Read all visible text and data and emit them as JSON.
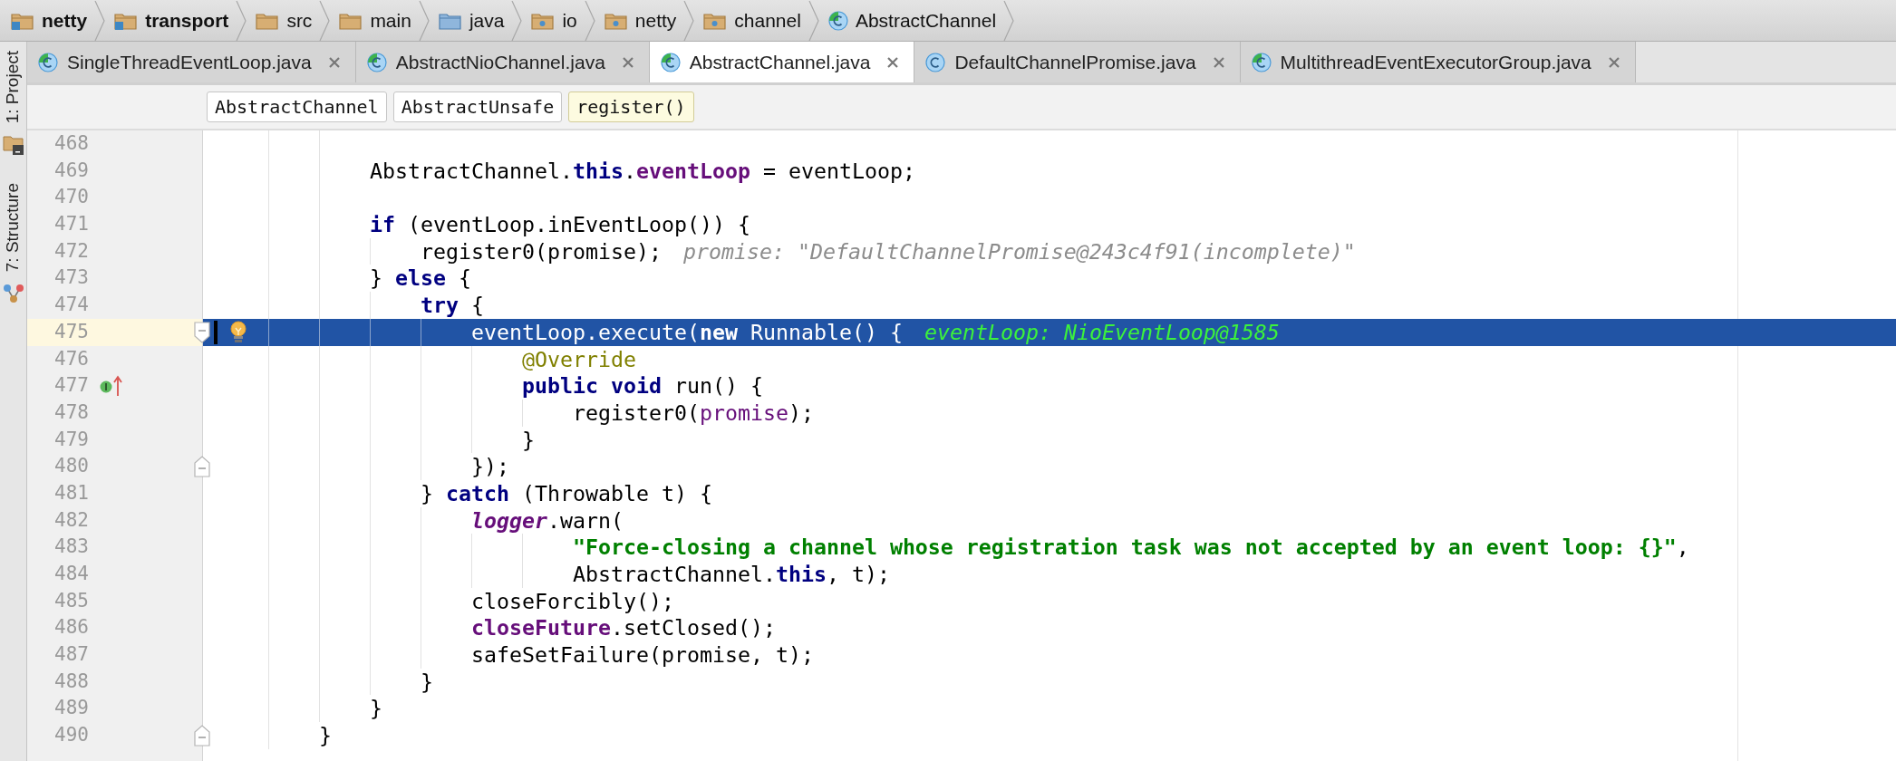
{
  "breadcrumbs": [
    {
      "label": "netty",
      "kind": "module"
    },
    {
      "label": "transport",
      "kind": "module"
    },
    {
      "label": "src",
      "kind": "folder"
    },
    {
      "label": "main",
      "kind": "folder"
    },
    {
      "label": "java",
      "kind": "source-folder"
    },
    {
      "label": "io",
      "kind": "package"
    },
    {
      "label": "netty",
      "kind": "package"
    },
    {
      "label": "channel",
      "kind": "package"
    },
    {
      "label": "AbstractChannel",
      "kind": "class-marked"
    }
  ],
  "tool_strip": [
    {
      "label": "1: Project",
      "kind": "project"
    },
    {
      "label": "7: Structure",
      "kind": "structure"
    }
  ],
  "tabs": [
    {
      "label": "SingleThreadEventLoop.java",
      "kind": "class-marked",
      "selected": false
    },
    {
      "label": "AbstractNioChannel.java",
      "kind": "class-marked",
      "selected": false
    },
    {
      "label": "AbstractChannel.java",
      "kind": "class-marked",
      "selected": true
    },
    {
      "label": "DefaultChannelPromise.java",
      "kind": "class",
      "selected": false
    },
    {
      "label": "MultithreadEventExecutorGroup.java",
      "kind": "class-marked",
      "selected": false
    }
  ],
  "method_path": [
    {
      "label": "AbstractChannel",
      "selected": false
    },
    {
      "label": "AbstractUnsafe",
      "selected": false
    },
    {
      "label": "register()",
      "selected": true
    }
  ],
  "lines": [
    {
      "number": "468",
      "selected": false
    },
    {
      "number": "469",
      "selected": false,
      "tokens": [
        {
          "kind": "plain",
          "text": "            AbstractChannel."
        },
        {
          "kind": "keyword",
          "text": "this"
        },
        {
          "kind": "plain",
          "text": "."
        },
        {
          "kind": "field",
          "text": "eventLoop"
        },
        {
          "kind": "plain",
          "text": " = eventLoop;"
        }
      ]
    },
    {
      "number": "470",
      "selected": false
    },
    {
      "number": "471",
      "selected": false,
      "tokens": [
        {
          "kind": "keyword",
          "text": "            if"
        },
        {
          "kind": "plain",
          "text": " (eventLoop.inEventLoop()) {"
        }
      ]
    },
    {
      "number": "472",
      "selected": false,
      "tokens": [
        {
          "kind": "plain",
          "text": "                register0(promise);"
        }
      ],
      "hint": "promise: \"DefaultChannelPromise@243c4f91(incomplete)\""
    },
    {
      "number": "473",
      "selected": false,
      "tokens": [
        {
          "kind": "plain",
          "text": "            } "
        },
        {
          "kind": "keyword",
          "text": "else"
        },
        {
          "kind": "plain",
          "text": " {"
        }
      ]
    },
    {
      "number": "474",
      "selected": false,
      "tokens": [
        {
          "kind": "keyword",
          "text": "                try"
        },
        {
          "kind": "plain",
          "text": " {"
        }
      ]
    },
    {
      "number": "475",
      "selected": true,
      "fold_start": true,
      "intention": true,
      "caret": true,
      "tokens": [
        {
          "kind": "plain",
          "text": "                    eventLoop.execute("
        },
        {
          "kind": "keyword",
          "text": "new"
        },
        {
          "kind": "plain",
          "text": " Runnable() {"
        }
      ],
      "hint": "eventLoop: NioEventLoop@1585"
    },
    {
      "number": "476",
      "selected": false,
      "tokens": [
        {
          "kind": "annotation",
          "text": "                        @Override"
        }
      ]
    },
    {
      "number": "477",
      "selected": false,
      "override_marker": true,
      "tokens": [
        {
          "kind": "keyword",
          "text": "                        public void"
        },
        {
          "kind": "plain",
          "text": " run() {"
        }
      ]
    },
    {
      "number": "478",
      "selected": false,
      "tokens": [
        {
          "kind": "plain",
          "text": "                            register0("
        },
        {
          "kind": "param",
          "text": "promise"
        },
        {
          "kind": "plain",
          "text": ");"
        }
      ]
    },
    {
      "number": "479",
      "selected": false,
      "tokens": [
        {
          "kind": "plain",
          "text": "                        }"
        }
      ]
    },
    {
      "number": "480",
      "selected": false,
      "fold_end": true,
      "tokens": [
        {
          "kind": "plain",
          "text": "                    });"
        }
      ]
    },
    {
      "number": "481",
      "selected": false,
      "tokens": [
        {
          "kind": "plain",
          "text": "                } "
        },
        {
          "kind": "keyword",
          "text": "catch"
        },
        {
          "kind": "plain",
          "text": " (Throwable t) {"
        }
      ]
    },
    {
      "number": "482",
      "selected": false,
      "tokens": [
        {
          "kind": "static",
          "text": "                    logger"
        },
        {
          "kind": "plain",
          "text": ".warn("
        }
      ]
    },
    {
      "number": "483",
      "selected": false,
      "tokens": [
        {
          "kind": "string",
          "text": "                            \"Force-closing a channel whose registration task was not accepted by an event loop: {}\""
        },
        {
          "kind": "plain",
          "text": ","
        }
      ]
    },
    {
      "number": "484",
      "selected": false,
      "tokens": [
        {
          "kind": "plain",
          "text": "                            AbstractChannel."
        },
        {
          "kind": "keyword",
          "text": "this"
        },
        {
          "kind": "plain",
          "text": ", t);"
        }
      ]
    },
    {
      "number": "485",
      "selected": false,
      "tokens": [
        {
          "kind": "plain",
          "text": "                    closeForcibly();"
        }
      ]
    },
    {
      "number": "486",
      "selected": false,
      "tokens": [
        {
          "kind": "field",
          "text": "                    closeFuture"
        },
        {
          "kind": "plain",
          "text": ".setClosed();"
        }
      ]
    },
    {
      "number": "487",
      "selected": false,
      "tokens": [
        {
          "kind": "plain",
          "text": "                    safeSetFailure(promise, t);"
        }
      ]
    },
    {
      "number": "488",
      "selected": false,
      "tokens": [
        {
          "kind": "plain",
          "text": "                }"
        }
      ]
    },
    {
      "number": "489",
      "selected": false,
      "tokens": [
        {
          "kind": "plain",
          "text": "            }"
        }
      ]
    },
    {
      "number": "490",
      "selected": false,
      "fold_end": true,
      "tokens": [
        {
          "kind": "plain",
          "text": "        }"
        }
      ]
    }
  ]
}
